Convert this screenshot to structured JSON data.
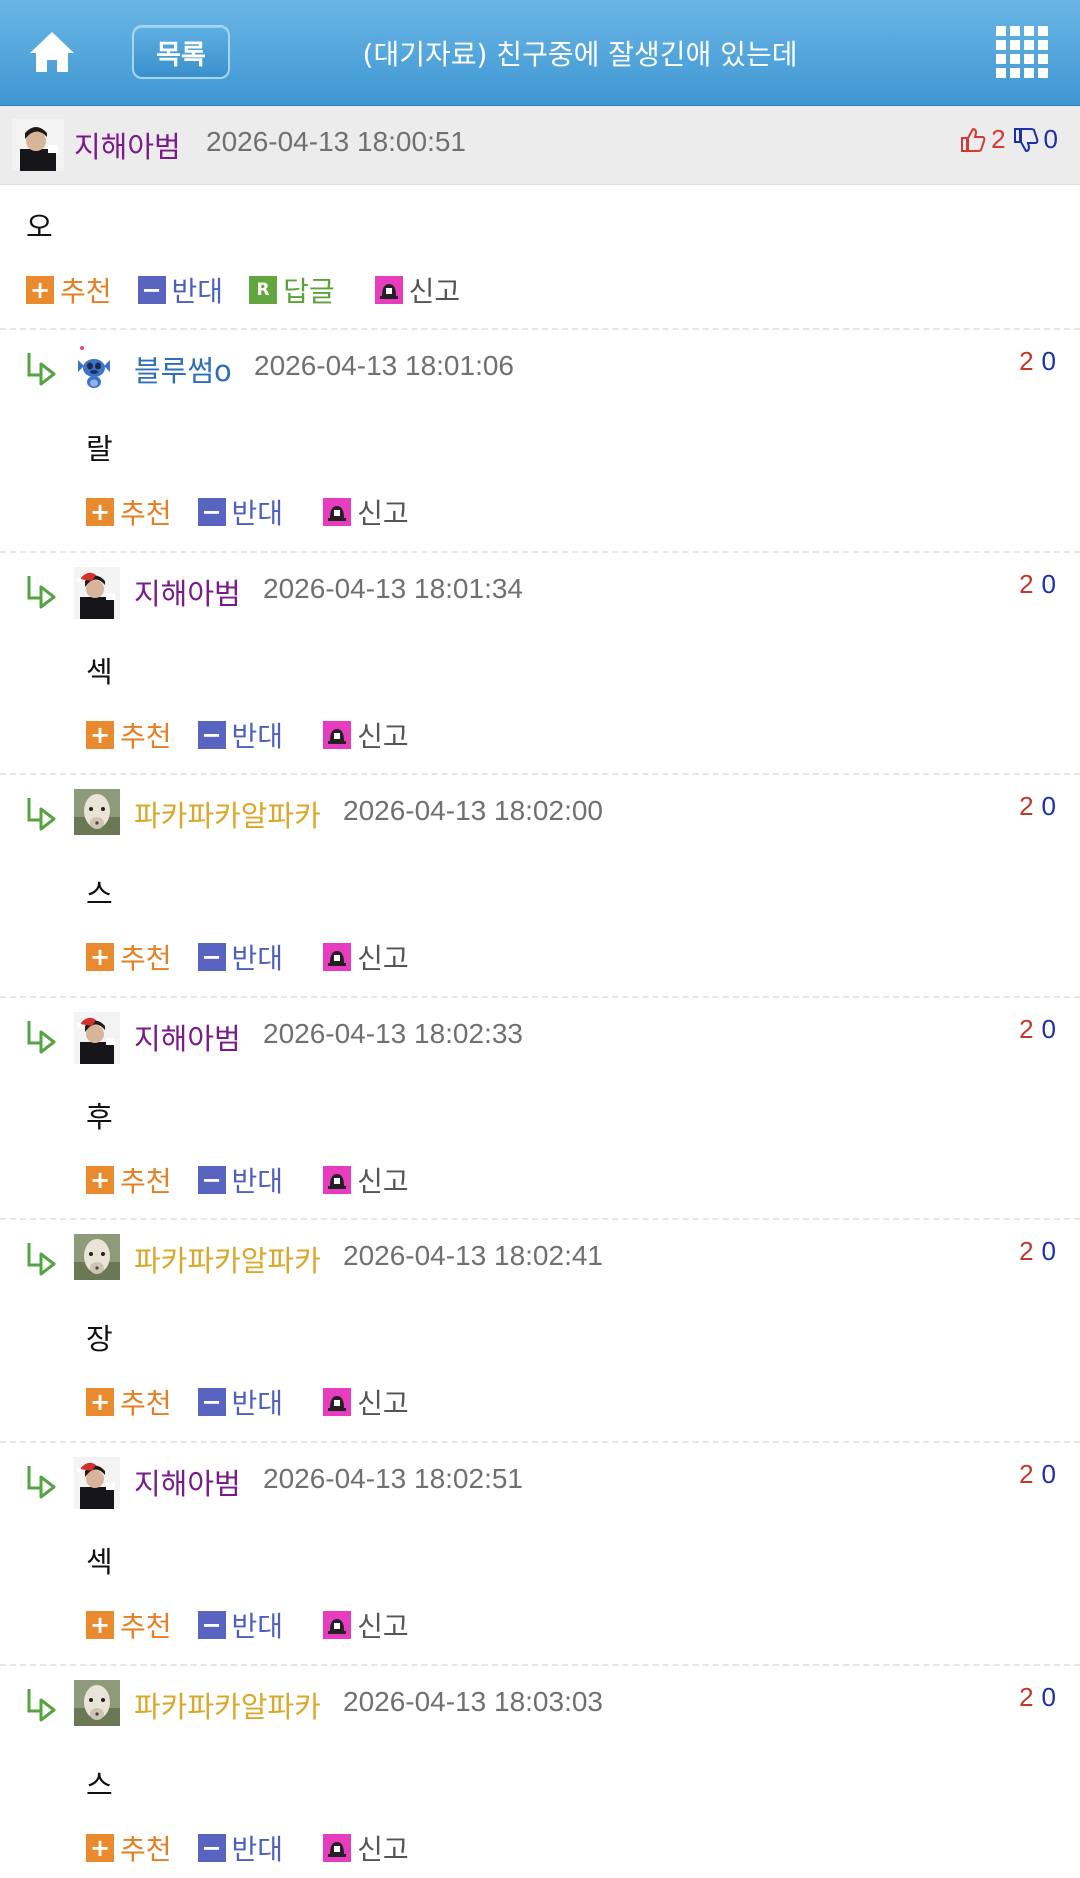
{
  "header": {
    "list_label": "목록",
    "title": "(대기자료) 친구중에 잘생긴애 있는데",
    "bg_color": "#4aa3db"
  },
  "post": {
    "author": "지해아범",
    "date": "2026-04-13 18:00:51",
    "up": "2",
    "down": "0",
    "body": "오",
    "actions": {
      "recommend": "추천",
      "oppose": "반대",
      "reply": "답글",
      "report": "신고"
    }
  },
  "comments": [
    {
      "author": "블루썸o",
      "author_color": "#2f6fb8",
      "avatar": "stitch",
      "date": "2026-04-13 18:01:06",
      "up": "2",
      "down": "0",
      "body": "랄"
    },
    {
      "author": "지해아범",
      "author_color": "#7a1b8a",
      "avatar": "person",
      "date": "2026-04-13 18:01:34",
      "up": "2",
      "down": "0",
      "body": "섹"
    },
    {
      "author": "파카파카알파카",
      "author_color": "#d9a82a",
      "avatar": "alpaca",
      "date": "2026-04-13 18:02:00",
      "up": "2",
      "down": "0",
      "body": "스"
    },
    {
      "author": "지해아범",
      "author_color": "#7a1b8a",
      "avatar": "person",
      "date": "2026-04-13 18:02:33",
      "up": "2",
      "down": "0",
      "body": "후"
    },
    {
      "author": "파카파카알파카",
      "author_color": "#d9a82a",
      "avatar": "alpaca",
      "date": "2026-04-13 18:02:41",
      "up": "2",
      "down": "0",
      "body": "장"
    },
    {
      "author": "지해아범",
      "author_color": "#7a1b8a",
      "avatar": "person",
      "date": "2026-04-13 18:02:51",
      "up": "2",
      "down": "0",
      "body": "섹"
    },
    {
      "author": "파카파카알파카",
      "author_color": "#d9a82a",
      "avatar": "alpaca",
      "date": "2026-04-13 18:03:03",
      "up": "2",
      "down": "0",
      "body": "스"
    }
  ],
  "comment_actions": {
    "recommend": "추천",
    "oppose": "반대",
    "report": "신고"
  },
  "colors": {
    "recommend": "#ea8a2e",
    "oppose": "#5864c0",
    "reply": "#63a63f",
    "report": "#e73cbd"
  }
}
